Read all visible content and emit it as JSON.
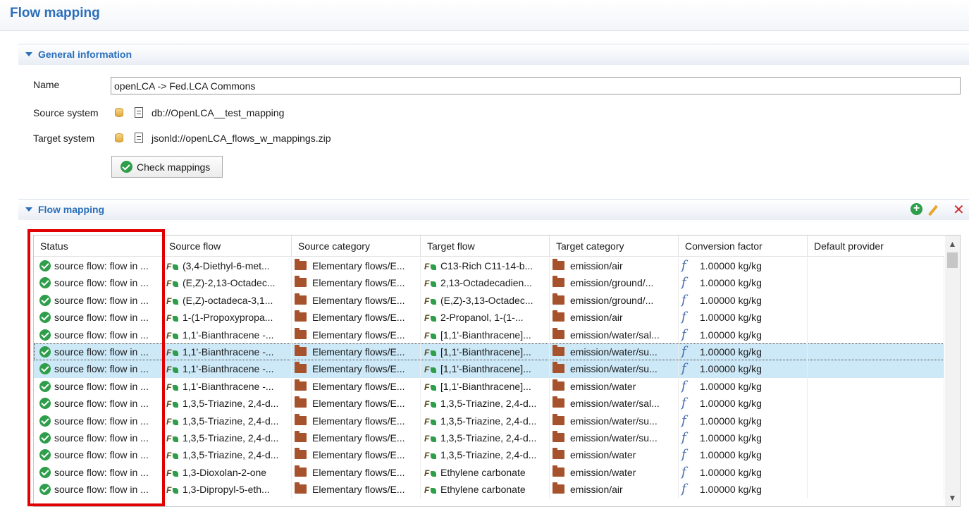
{
  "page": {
    "title": "Flow mapping"
  },
  "general_section": {
    "heading": "General information",
    "name_label": "Name",
    "name_value": "openLCA -> Fed.LCA Commons",
    "source_label": "Source system",
    "source_value": "db://OpenLCA__test_mapping",
    "target_label": "Target system",
    "target_value": "jsonld://openLCA_flows_w_mappings.zip",
    "check_button": "Check mappings"
  },
  "mapping_section": {
    "heading": "Flow mapping",
    "add_icon": "add-icon",
    "edit_icon": "pencil-icon",
    "delete_icon": "delete-icon"
  },
  "colors": {
    "accent": "#2a6ebb",
    "ok": "#2e9e4a",
    "selected_row": "#cde8f7",
    "highlight_box": "#e10000"
  },
  "table": {
    "columns": [
      "Status",
      "Source flow",
      "Source category",
      "Target flow",
      "Target category",
      "Conversion factor",
      "Default provider"
    ],
    "rows": [
      {
        "status": "source flow: flow in ...",
        "source_flow": "(3,4-Diethyl-6-met...",
        "source_category": "Elementary flows/E...",
        "target_flow": "C13-Rich C11-14-b...",
        "target_category": "emission/air",
        "factor": "1.00000 kg/kg",
        "provider": "",
        "selected": false
      },
      {
        "status": "source flow: flow in ...",
        "source_flow": "(E,Z)-2,13-Octadec...",
        "source_category": "Elementary flows/E...",
        "target_flow": "2,13-Octadecadien...",
        "target_category": "emission/ground/...",
        "factor": "1.00000 kg/kg",
        "provider": "",
        "selected": false
      },
      {
        "status": "source flow: flow in ...",
        "source_flow": "(E,Z)-octadeca-3,1...",
        "source_category": "Elementary flows/E...",
        "target_flow": "(E,Z)-3,13-Octadec...",
        "target_category": "emission/ground/...",
        "factor": "1.00000 kg/kg",
        "provider": "",
        "selected": false
      },
      {
        "status": "source flow: flow in ...",
        "source_flow": "1-(1-Propoxypropa...",
        "source_category": "Elementary flows/E...",
        "target_flow": "2-Propanol, 1-(1-...",
        "target_category": "emission/air",
        "factor": "1.00000 kg/kg",
        "provider": "",
        "selected": false
      },
      {
        "status": "source flow: flow in ...",
        "source_flow": "1,1'-Bianthracene -...",
        "source_category": "Elementary flows/E...",
        "target_flow": "[1,1'-Bianthracene]...",
        "target_category": "emission/water/sal...",
        "factor": "1.00000 kg/kg",
        "provider": "",
        "selected": false
      },
      {
        "status": "source flow: flow in ...",
        "source_flow": "1,1'-Bianthracene -...",
        "source_category": "Elementary flows/E...",
        "target_flow": "[1,1'-Bianthracene]...",
        "target_category": "emission/water/su...",
        "factor": "1.00000 kg/kg",
        "provider": "",
        "selected": true
      },
      {
        "status": "source flow: flow in ...",
        "source_flow": "1,1'-Bianthracene -...",
        "source_category": "Elementary flows/E...",
        "target_flow": "[1,1'-Bianthracene]...",
        "target_category": "emission/water/su...",
        "factor": "1.00000 kg/kg",
        "provider": "",
        "selected": true
      },
      {
        "status": "source flow: flow in ...",
        "source_flow": "1,1'-Bianthracene -...",
        "source_category": "Elementary flows/E...",
        "target_flow": "[1,1'-Bianthracene]...",
        "target_category": "emission/water",
        "factor": "1.00000 kg/kg",
        "provider": "",
        "selected": false
      },
      {
        "status": "source flow: flow in ...",
        "source_flow": "1,3,5-Triazine, 2,4-d...",
        "source_category": "Elementary flows/E...",
        "target_flow": "1,3,5-Triazine, 2,4-d...",
        "target_category": "emission/water/sal...",
        "factor": "1.00000 kg/kg",
        "provider": "",
        "selected": false
      },
      {
        "status": "source flow: flow in ...",
        "source_flow": "1,3,5-Triazine, 2,4-d...",
        "source_category": "Elementary flows/E...",
        "target_flow": "1,3,5-Triazine, 2,4-d...",
        "target_category": "emission/water/su...",
        "factor": "1.00000 kg/kg",
        "provider": "",
        "selected": false
      },
      {
        "status": "source flow: flow in ...",
        "source_flow": "1,3,5-Triazine, 2,4-d...",
        "source_category": "Elementary flows/E...",
        "target_flow": "1,3,5-Triazine, 2,4-d...",
        "target_category": "emission/water/su...",
        "factor": "1.00000 kg/kg",
        "provider": "",
        "selected": false
      },
      {
        "status": "source flow: flow in ...",
        "source_flow": "1,3,5-Triazine, 2,4-d...",
        "source_category": "Elementary flows/E...",
        "target_flow": "1,3,5-Triazine, 2,4-d...",
        "target_category": "emission/water",
        "factor": "1.00000 kg/kg",
        "provider": "",
        "selected": false
      },
      {
        "status": "source flow: flow in ...",
        "source_flow": "1,3-Dioxolan-2-one",
        "source_category": "Elementary flows/E...",
        "target_flow": "Ethylene carbonate",
        "target_category": "emission/water",
        "factor": "1.00000 kg/kg",
        "provider": "",
        "selected": false
      },
      {
        "status": "source flow: flow in ...",
        "source_flow": "1,3-Dipropyl-5-eth...",
        "source_category": "Elementary flows/E...",
        "target_flow": "Ethylene carbonate",
        "target_category": "emission/air",
        "factor": "1.00000 kg/kg",
        "provider": "",
        "selected": false
      }
    ]
  }
}
